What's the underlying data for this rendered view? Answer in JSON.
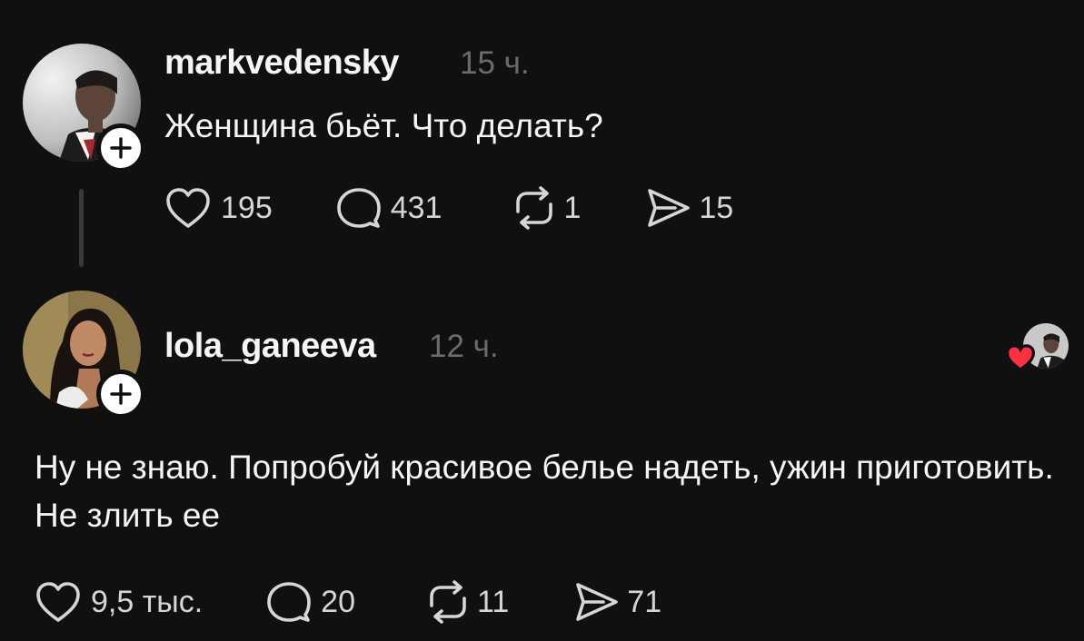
{
  "posts": [
    {
      "username": "markvedensky",
      "time": "15 ч.",
      "text": "Женщина бьёт. Что делать?",
      "likes": "195",
      "replies": "431",
      "reposts": "1",
      "shares": "15"
    },
    {
      "username": "lola_ganeeva",
      "time": "12 ч.",
      "text": "Ну не знаю. Попробуй красивое белье надеть, ужин приготовить. Не злить ее",
      "likes": "9,5 тыс.",
      "replies": "20",
      "reposts": "11",
      "shares": "71"
    }
  ],
  "icons": {
    "like": "heart-icon",
    "reply": "comment-bubble-icon",
    "repost": "repost-arrows-icon",
    "share": "send-arrow-icon",
    "follow": "plus-icon",
    "liked_by_author": "red-heart-icon"
  },
  "colors": {
    "background": "#101010",
    "text": "#f3f5f7",
    "muted": "#6b6b6b",
    "like_red": "#ff3040"
  }
}
